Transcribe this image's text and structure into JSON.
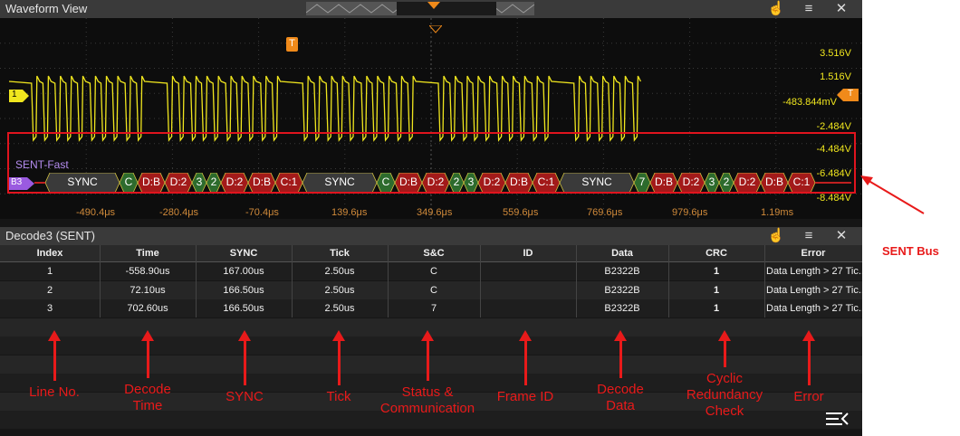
{
  "waveform": {
    "title": "Waveform View",
    "trigger_marker": "T",
    "channel_marker": "1",
    "right_marker": "T",
    "voltages": [
      "3.516V",
      "1.516V",
      "-483.844mV",
      "-2.484V",
      "-4.484V",
      "-6.484V",
      "-8.484V"
    ],
    "times": [
      "-490.4μs",
      "-280.4μs",
      "-70.4μs",
      "139.6μs",
      "349.6μs",
      "559.6μs",
      "769.6μs",
      "979.6μs",
      "1.19ms"
    ],
    "trace_color": "#f0e61e"
  },
  "bus": {
    "label": "SENT-Fast",
    "tag": "B3",
    "segments": [
      "SYNC",
      "C",
      "D:B",
      "D:2",
      "3",
      "2",
      "D:2",
      "D:B",
      "C:1",
      "SYNC",
      "C",
      "D:B",
      "D:2",
      "2",
      "3",
      "D:2",
      "D:B",
      "C:1",
      "SYNC",
      "7",
      "D:B",
      "D:2",
      "3",
      "2",
      "D:2",
      "D:B",
      "C:1"
    ],
    "colors": {
      "sync": "#3a3a3a",
      "status": "#2d6b2d",
      "data": "#a31a1a",
      "crc": "#a31a1a"
    }
  },
  "decode": {
    "title": "Decode3 (SENT)",
    "columns": [
      "Index",
      "Time",
      "SYNC",
      "Tick",
      "S&C",
      "ID",
      "Data",
      "CRC",
      "Error"
    ],
    "rows": [
      [
        "1",
        "-558.90us",
        "167.00us",
        "2.50us",
        "C",
        "",
        "B2322B",
        "1",
        "Data Length > 27 Tic..."
      ],
      [
        "2",
        "72.10us",
        "166.50us",
        "2.50us",
        "C",
        "",
        "B2322B",
        "1",
        "Data Length > 27 Tic..."
      ],
      [
        "3",
        "702.60us",
        "166.50us",
        "2.50us",
        "7",
        "",
        "B2322B",
        "1",
        "Data Length > 27 Tic..."
      ]
    ]
  },
  "annotations": {
    "bus_label": "SENT Bus",
    "labels": [
      "Line No.",
      "Decode\nTime",
      "SYNC",
      "Tick",
      "Status &\nCommunication",
      "Frame ID",
      "Decode\nData",
      "Cyclic\nRedundancy\nCheck",
      "Error"
    ]
  }
}
